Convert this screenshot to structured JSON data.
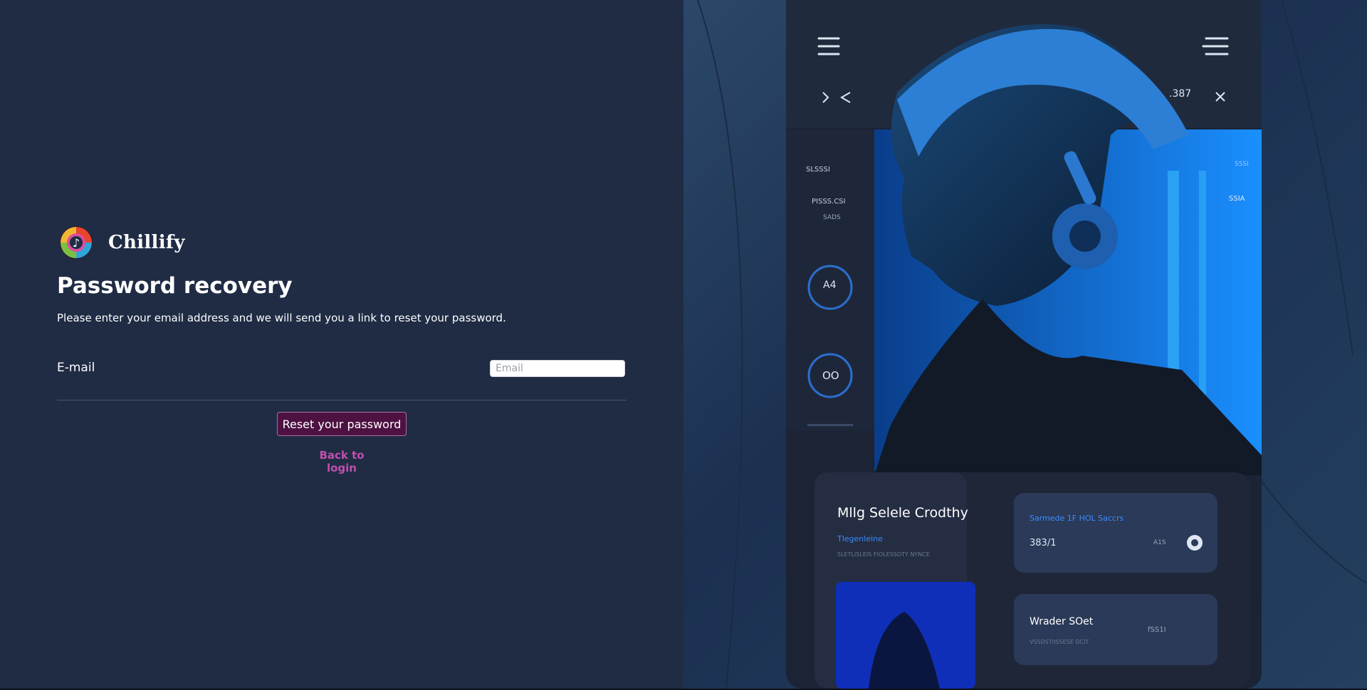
{
  "brand": {
    "name": "Chillify"
  },
  "form": {
    "title": "Password recovery",
    "description": "Please enter your email address and we will send you a link to reset your password.",
    "email_label": "E-mail",
    "email_placeholder": "Email",
    "email_value": "",
    "reset_button": "Reset your password",
    "back_link": "Back to login"
  },
  "artwork": {
    "top_number": ".387",
    "dial_1": "A4",
    "dial_2": "OO",
    "side_labels": [
      "SLSSSI",
      "PISSS.CSI",
      "SADS"
    ],
    "right_labels": [
      "SSSI",
      "SSIA"
    ],
    "card_title": "Mllg Selele Crodthy",
    "card_subtitle": "Tlegenleine",
    "card_caption": "SLETLISLEIS FIOLESSOTY NYNCE",
    "tile1_title": "Sarmede 1F HOL Saccrs",
    "tile1_value": "383/1",
    "tile1_small": "A1S",
    "tile2_title": "Wrader SOet",
    "tile2_value": "fSS1I",
    "tile2_caption": "VSSDSTIISSESE DCIT"
  },
  "colors": {
    "left_bg": "#1f2c44",
    "button_bg": "#4d1142",
    "link": "#c24fae",
    "art_accent": "#3aa3ff"
  }
}
